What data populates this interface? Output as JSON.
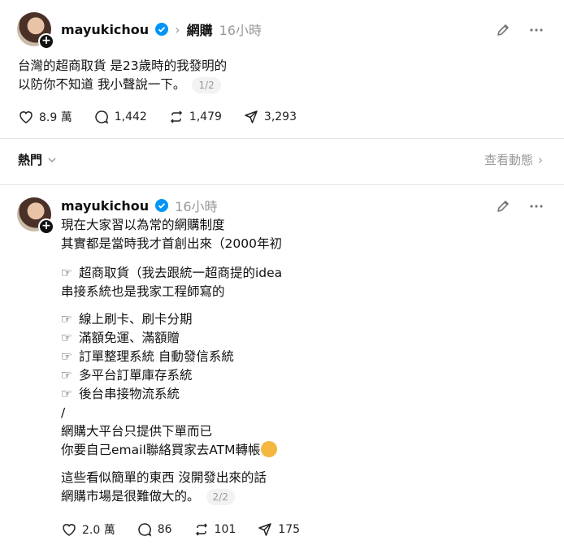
{
  "post1": {
    "username": "mayukichou",
    "topic": "網購",
    "time": "16小時",
    "line1": "台灣的超商取貨 是23歲時的我發明的",
    "line2": "以防你不知道 我小聲說一下。",
    "pager": "1/2",
    "likes": "8.9 萬",
    "comments": "1,442",
    "reposts": "1,479",
    "shares": "3,293"
  },
  "feed": {
    "sort_label": "熱門",
    "view_activity": "查看動態"
  },
  "post2": {
    "username": "mayukichou",
    "time": "16小時",
    "p1_l1": "現在大家習以為常的網購制度",
    "p1_l2": "其實都是當時我才首創出來（2000年初",
    "b1_l1": "超商取貨（我去跟統一超商提的idea",
    "b1_l2": "串接系統也是我家工程師寫的",
    "bullets": [
      "線上刷卡、刷卡分期",
      "滿額免運、滿額贈",
      "訂單整理系統 自動發信系統",
      "多平台訂單庫存系統",
      "後台串接物流系統"
    ],
    "slash": "/",
    "p3_l1": "網購大平台只提供下單而已",
    "p3_l2": "你要自己email聯絡買家去ATM轉帳",
    "p4_l1": "這些看似簡單的東西 沒開發出來的話",
    "p4_l2": "網購市場是很難做大的。",
    "pager": "2/2",
    "likes": "2.0 萬",
    "comments": "86",
    "reposts": "101",
    "shares": "175"
  },
  "icons": {
    "verified_color": "#0095f6",
    "hand": "backhand-index-pointing-right",
    "face": "disappointed-face"
  }
}
